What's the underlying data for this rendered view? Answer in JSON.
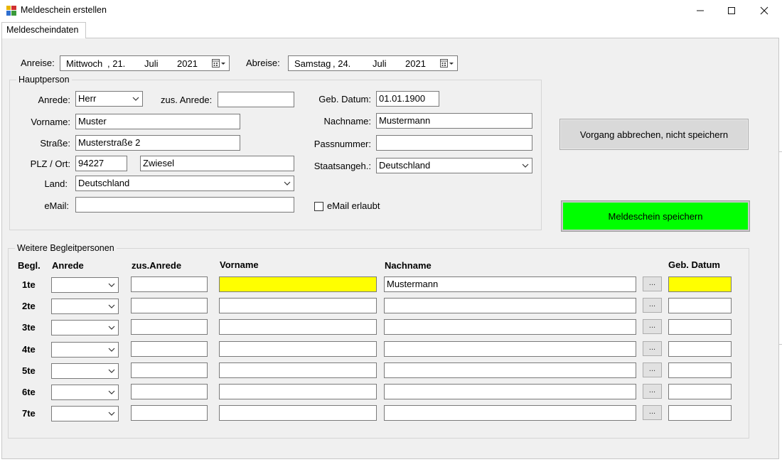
{
  "window": {
    "title": "Meldeschein erstellen",
    "minimize_glyph": "—",
    "maximize_glyph": "☐",
    "close_glyph": "✕"
  },
  "tab": {
    "label": "Meldescheindaten"
  },
  "stay": {
    "arrival_label": "Anreise:",
    "arrival_weekday": "Mittwoch",
    "arrival_day": ",  21.",
    "arrival_month": "Juli",
    "arrival_year": "2021",
    "departure_label": "Abreise:",
    "departure_weekday": "Samstag",
    "departure_day": ",  24.",
    "departure_month": "Juli",
    "departure_year": "2021"
  },
  "main_person": {
    "group_title": "Hauptperson",
    "salutation_label": "Anrede:",
    "salutation_value": "Herr",
    "extra_salutation_label": "zus. Anrede:",
    "extra_salutation_value": "",
    "birthdate_label": "Geb. Datum:",
    "birthdate_value": "01.01.1900",
    "firstname_label": "Vorname:",
    "firstname_value": "Muster",
    "lastname_label": "Nachname:",
    "lastname_value": "Mustermann",
    "street_label": "Straße:",
    "street_value": "Musterstraße 2",
    "passport_label": "Passnummer:",
    "passport_value": "",
    "zipcity_label": "PLZ / Ort:",
    "zip_value": "94227",
    "city_value": "Zwiesel",
    "nationality_label": "Staatsangeh.:",
    "nationality_value": "Deutschland",
    "country_label": "Land:",
    "country_value": "Deutschland",
    "email_label": "eMail:",
    "email_value": "",
    "email_allowed_label": "eMail erlaubt",
    "email_allowed": false
  },
  "buttons": {
    "cancel_label": "Vorgang abbrechen, nicht speichern",
    "save_label": "Meldeschein speichern",
    "save_color": "#00ff00"
  },
  "companions": {
    "group_title": "Weitere Begleitpersonen",
    "headers": {
      "index": "Begl.",
      "salutation": "Anrede",
      "extra_salutation": "zus.Anrede",
      "firstname": "Vorname",
      "lastname": "Nachname",
      "birthdate": "Geb. Datum"
    },
    "ellipsis_label": "...",
    "highlight_color": "#ffff00",
    "rows": [
      {
        "label": "1te",
        "salutation": "",
        "extra": "",
        "firstname": "",
        "lastname": "Mustermann",
        "birthdate": "",
        "highlight": true
      },
      {
        "label": "2te",
        "salutation": "",
        "extra": "",
        "firstname": "",
        "lastname": "",
        "birthdate": "",
        "highlight": false
      },
      {
        "label": "3te",
        "salutation": "",
        "extra": "",
        "firstname": "",
        "lastname": "",
        "birthdate": "",
        "highlight": false
      },
      {
        "label": "4te",
        "salutation": "",
        "extra": "",
        "firstname": "",
        "lastname": "",
        "birthdate": "",
        "highlight": false
      },
      {
        "label": "5te",
        "salutation": "",
        "extra": "",
        "firstname": "",
        "lastname": "",
        "birthdate": "",
        "highlight": false
      },
      {
        "label": "6te",
        "salutation": "",
        "extra": "",
        "firstname": "",
        "lastname": "",
        "birthdate": "",
        "highlight": false
      },
      {
        "label": "7te",
        "salutation": "",
        "extra": "",
        "firstname": "",
        "lastname": "",
        "birthdate": "",
        "highlight": false
      }
    ]
  }
}
